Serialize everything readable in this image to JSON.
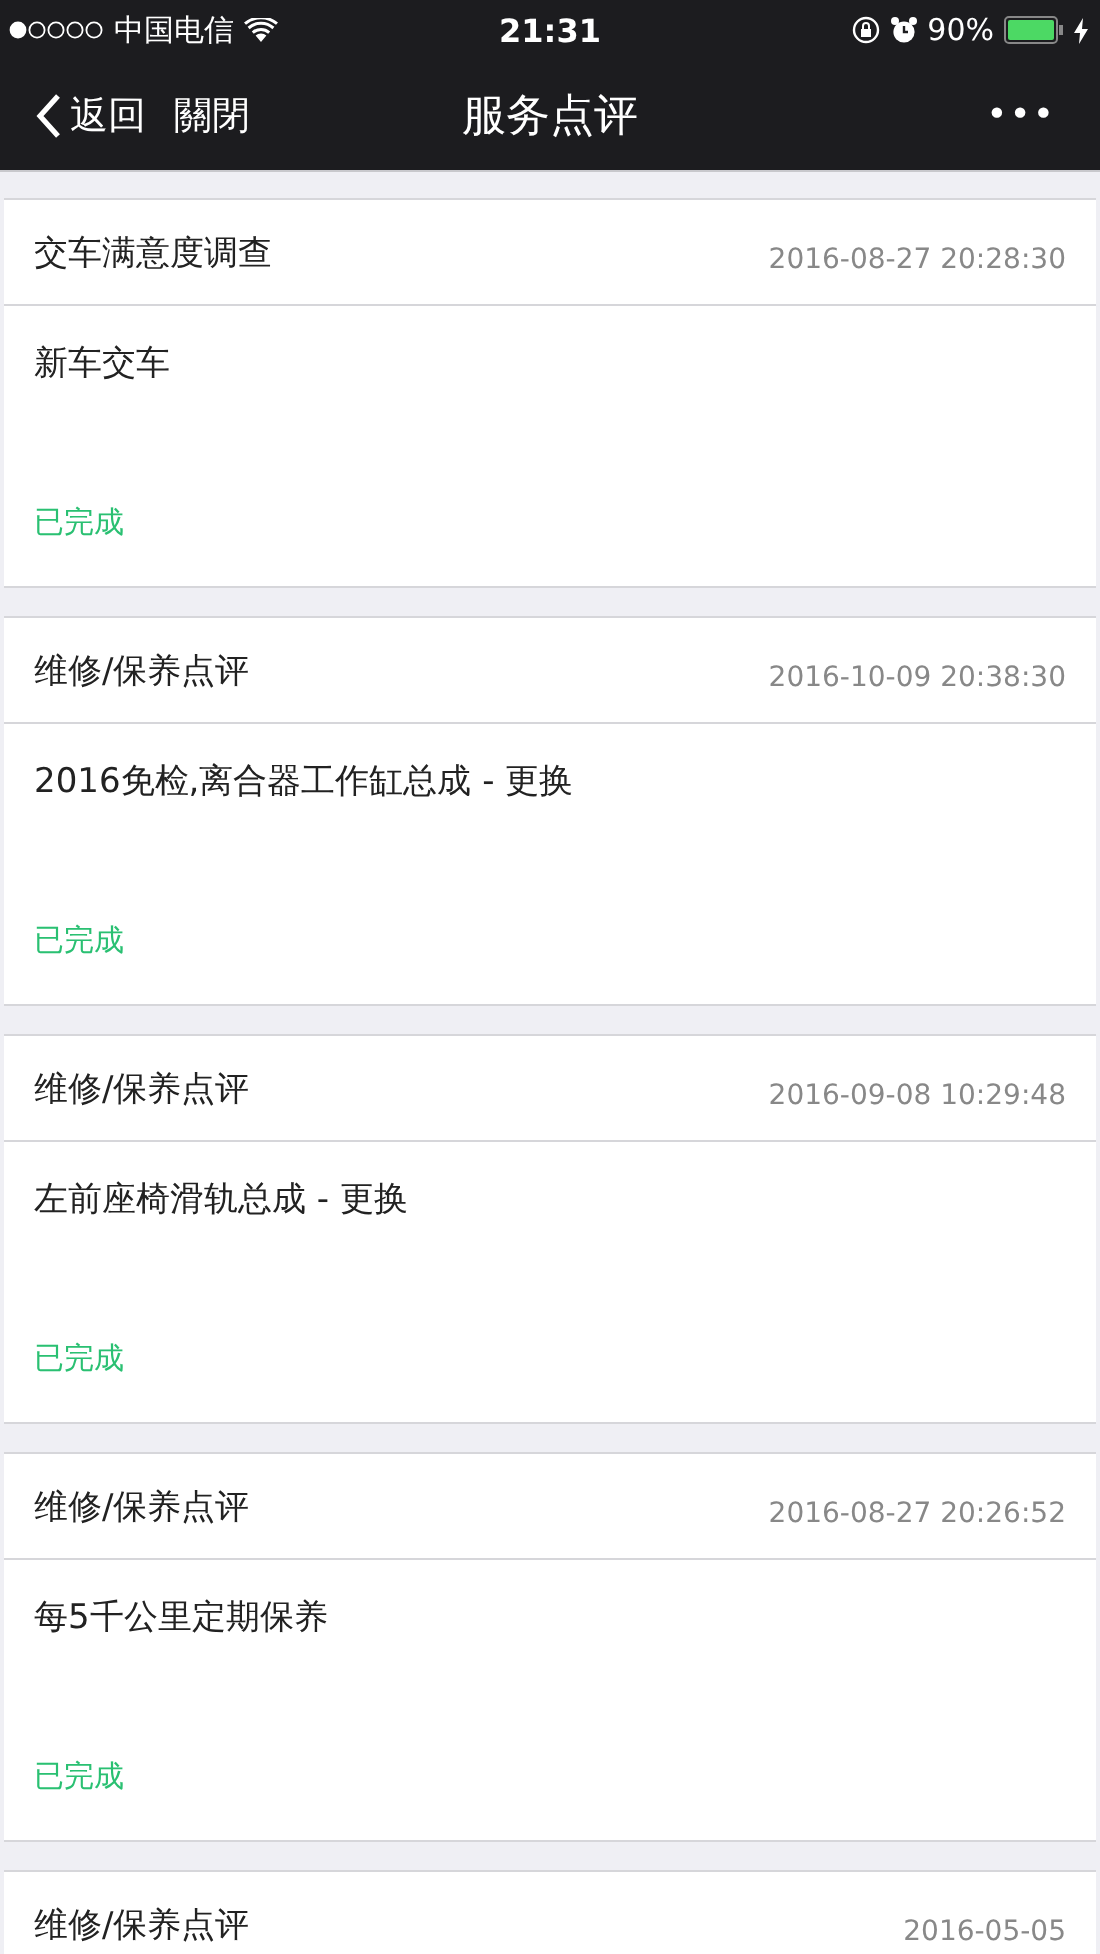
{
  "status_bar": {
    "carrier": "中国电信",
    "time": "21:31",
    "battery": "90%"
  },
  "nav": {
    "back": "返回",
    "close": "關閉",
    "title": "服务点评",
    "more": "•••"
  },
  "reviews": [
    {
      "type": "交车满意度调查",
      "date": "2016-08-27 20:28:30",
      "item": "新车交车",
      "status": "已完成"
    },
    {
      "type": "维修/保养点评",
      "date": "2016-10-09 20:38:30",
      "item": "2016免检,离合器工作缸总成 - 更换",
      "status": "已完成"
    },
    {
      "type": "维修/保养点评",
      "date": "2016-09-08 10:29:48",
      "item": "左前座椅滑轨总成 - 更换",
      "status": "已完成"
    },
    {
      "type": "维修/保养点评",
      "date": "2016-08-27 20:26:52",
      "item": "每5千公里定期保养",
      "status": "已完成"
    },
    {
      "type": "维修/保养点评",
      "date": "2016-05-05"
    }
  ]
}
